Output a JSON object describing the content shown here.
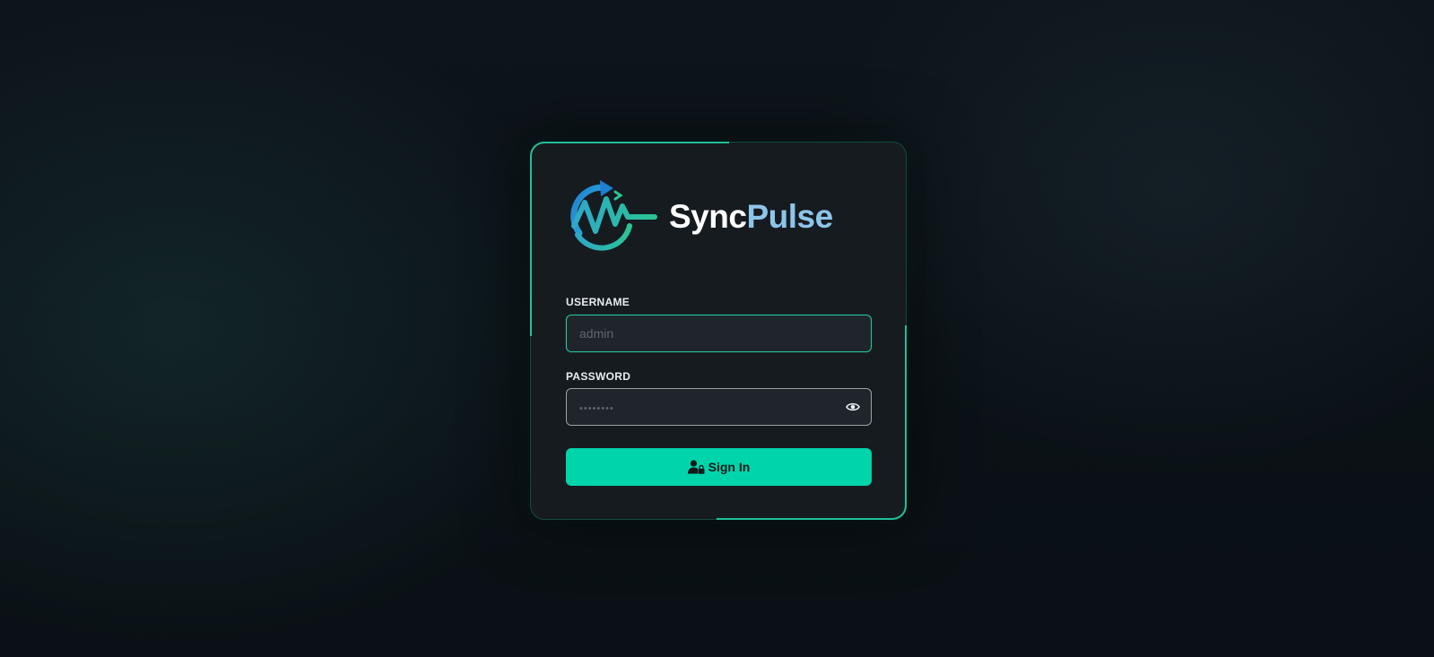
{
  "brand": {
    "name_part1": "Sync",
    "name_part2": "Pulse",
    "logo_icon": "sync-pulse-logo-icon"
  },
  "form": {
    "username": {
      "label": "USERNAME",
      "placeholder": "admin",
      "value": ""
    },
    "password": {
      "label": "PASSWORD",
      "placeholder": "••••••••",
      "value": "",
      "toggle_icon": "eye-icon"
    },
    "submit": {
      "label": "Sign In",
      "icon": "user-lock-icon"
    }
  },
  "colors": {
    "accent": "#00d4aa",
    "card_background": "#161b20",
    "page_background": "#0b1217",
    "brand_secondary_text": "#8ec5ea"
  }
}
